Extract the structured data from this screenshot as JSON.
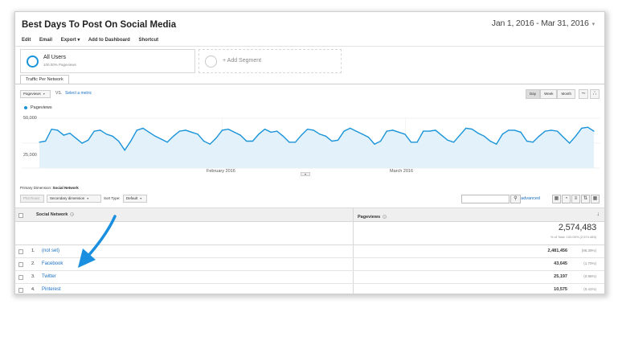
{
  "report": {
    "title": "Best Days To Post On Social Media",
    "date_range": "Jan 1, 2016 - Mar 31, 2016"
  },
  "toolbar": {
    "items": [
      "Edit",
      "Email",
      "Export ▾",
      "Add to Dashboard",
      "Shortcut"
    ]
  },
  "segments": {
    "all_users": {
      "name": "All Users",
      "sub": "100.00% Pageviews"
    },
    "add": "+ Add Segment"
  },
  "tabs": {
    "active": "Traffic Per Network"
  },
  "explorer": {
    "metric": "Pageviews",
    "vs": "VS.",
    "select_metric": "Select a metric",
    "granularity": [
      "Day",
      "Week",
      "Month"
    ],
    "active_granularity": "Day"
  },
  "chart_data": {
    "type": "area",
    "series": [
      {
        "name": "Pageviews",
        "values": [
          26000,
          27000,
          39000,
          38000,
          33000,
          35000,
          30000,
          25000,
          28000,
          37000,
          38000,
          34000,
          32000,
          27000,
          18000,
          27000,
          38000,
          40000,
          36000,
          32000,
          29000,
          26000,
          32000,
          37000,
          38000,
          36000,
          34000,
          27000,
          24000,
          30000,
          38000,
          39000,
          36000,
          33000,
          27000,
          27000,
          34000,
          39000,
          36000,
          37000,
          32000,
          26000,
          26000,
          33000,
          39000,
          38000,
          34000,
          32000,
          27000,
          28000,
          37000,
          40000,
          37000,
          34000,
          31000,
          24000,
          27000,
          37000,
          38000,
          36000,
          34000,
          26000,
          26000,
          37000,
          37000,
          38000,
          33000,
          28000,
          26000,
          33000,
          40000,
          39000,
          35000,
          32000,
          27000,
          24000,
          34000,
          38000,
          38000,
          36000,
          27000,
          26000,
          32000,
          37000,
          38000,
          37000,
          31000,
          25000,
          32000,
          40000,
          41000,
          37000
        ]
      }
    ],
    "x_labels": [
      "February 2016",
      "March 2016"
    ],
    "y_ticks": [
      "50,000",
      "25,000"
    ],
    "ylim": [
      0,
      50000
    ],
    "color": "#1a94d8",
    "fill": "#e3f1fb",
    "grid": true
  },
  "table": {
    "primary_dimension_label": "Primary Dimension:",
    "primary_dimension_value": "Social Network",
    "plot_rows": "Plot Rows",
    "secondary_dimension": "Secondary dimension",
    "sort_type_label": "Sort Type:",
    "sort_type_value": "Default",
    "advanced": "advanced",
    "col_dimension": "Social Network",
    "col_metric": "Pageviews",
    "total": "2,574,483",
    "total_sub": "% of Total: 100.00% (2,574,483)",
    "rows": [
      {
        "num": "1.",
        "name": "(not set)",
        "value": "2,481,456",
        "pct": "(96.39%)"
      },
      {
        "num": "2.",
        "name": "Facebook",
        "value": "43,645",
        "pct": "(1.70%)"
      },
      {
        "num": "3.",
        "name": "Twitter",
        "value": "25,197",
        "pct": "(0.98%)"
      },
      {
        "num": "4.",
        "name": "Pinterest",
        "value": "10,575",
        "pct": "(0.41%)"
      }
    ]
  },
  "annotation": {
    "arrow_color": "#1a8fe0"
  }
}
